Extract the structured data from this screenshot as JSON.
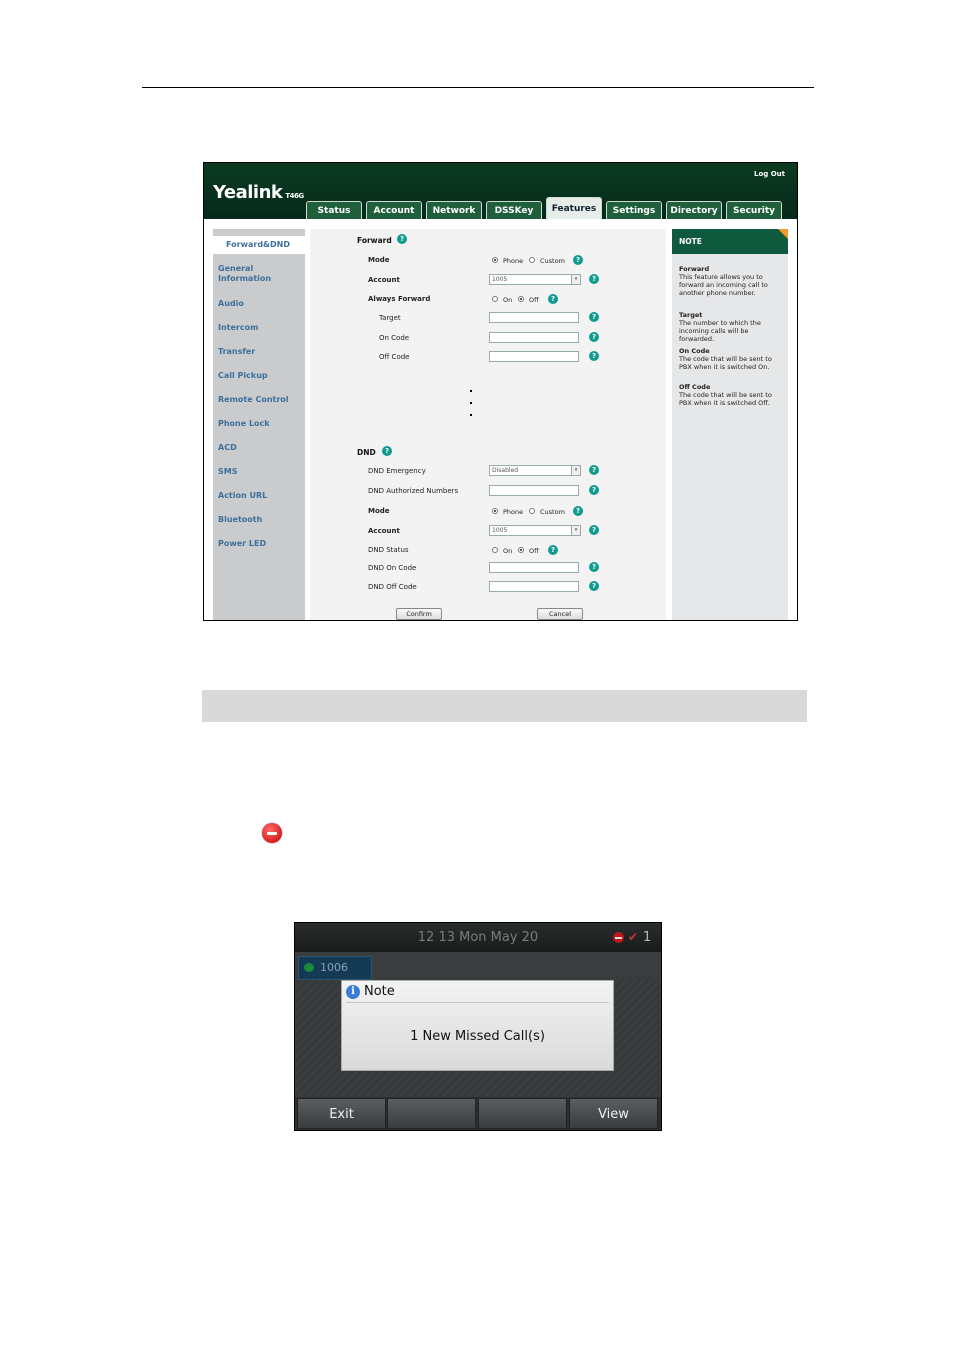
{
  "web": {
    "logo": "Yealink",
    "model": "T46G",
    "logout": "Log Out",
    "tabs": [
      "Status",
      "Account",
      "Network",
      "DSSKey",
      "Features",
      "Settings",
      "Directory",
      "Security"
    ],
    "active_tab": "Features",
    "sidebar": [
      "Forward&DND",
      "General Information",
      "Audio",
      "Intercom",
      "Transfer",
      "Call Pickup",
      "Remote Control",
      "Phone Lock",
      "ACD",
      "SMS",
      "Action URL",
      "Bluetooth",
      "Power LED"
    ],
    "forward": {
      "title": "Forward",
      "mode_label": "Mode",
      "mode_phone": "Phone",
      "mode_custom": "Custom",
      "account_label": "Account",
      "account_value": "1005",
      "always_label": "Always Forward",
      "on": "On",
      "off": "Off",
      "target_label": "Target",
      "on_code_label": "On Code",
      "off_code_label": "Off Code"
    },
    "dnd": {
      "title": "DND",
      "emergency_label": "DND Emergency",
      "emergency_value": "Disabled",
      "authorized_label": "DND Authorized Numbers",
      "mode_label": "Mode",
      "mode_phone": "Phone",
      "mode_custom": "Custom",
      "account_label": "Account",
      "account_value": "1005",
      "status_label": "DND Status",
      "on": "On",
      "off": "Off",
      "on_code_label": "DND On Code",
      "off_code_label": "DND Off Code"
    },
    "buttons": {
      "confirm": "Confirm",
      "cancel": "Cancel"
    },
    "note": {
      "title": "NOTE",
      "items": [
        {
          "heading": "Forward",
          "text": "This feature allows you to forward an incoming call to another phone number."
        },
        {
          "heading": "Target",
          "text": "The number to which the incoming calls will be forwarded."
        },
        {
          "heading": "On Code",
          "text": "The code that will be sent to PBX when it is switched On."
        },
        {
          "heading": "Off Code",
          "text": "The code that will be sent to PBX when it is switched Off."
        }
      ]
    }
  },
  "phone": {
    "datetime": "12 13 Mon May 20",
    "missed_count": "1",
    "line_label": "1006",
    "dialog_title": "Note",
    "dialog_message": "1 New Missed Call(s)",
    "softkeys": [
      "Exit",
      "",
      "",
      "View"
    ]
  }
}
